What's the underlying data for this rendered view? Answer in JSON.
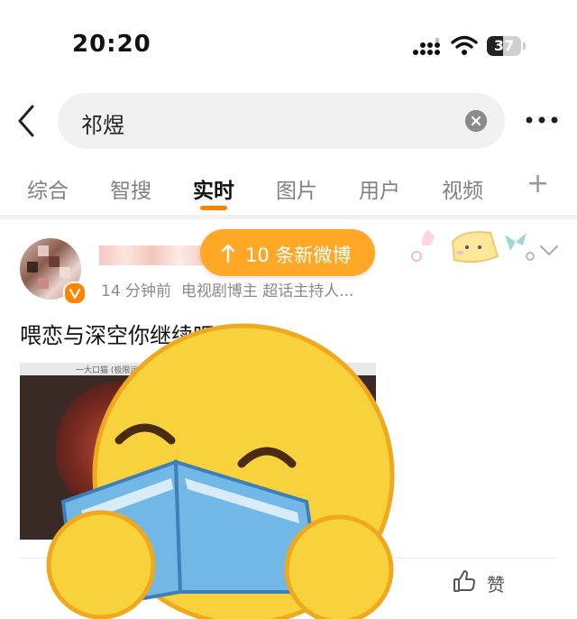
{
  "status_bar": {
    "time": "20:20",
    "battery_level": "37",
    "icons": [
      "cellular-signal-icon",
      "wifi-icon",
      "battery-icon"
    ]
  },
  "search": {
    "query": "祁煜",
    "icons": [
      "back-icon",
      "clear-icon",
      "more-icon"
    ]
  },
  "tabs": [
    {
      "label": "综合",
      "active": false
    },
    {
      "label": "智搜",
      "active": false
    },
    {
      "label": "实时",
      "active": true
    },
    {
      "label": "图片",
      "active": false
    },
    {
      "label": "用户",
      "active": false
    },
    {
      "label": "视频",
      "active": false
    }
  ],
  "tab_add_label": "+",
  "new_posts_pill": {
    "label": "10 条新微博"
  },
  "post": {
    "time_ago": "14 分钟前",
    "user_tags": "电视剧博主 超话主持人...",
    "text": "喂恋与深空你继续吧",
    "image_caption": "一大口猫 (极限运甲)"
  },
  "actions": {
    "like_label": "赞"
  },
  "accent_color": "#ff8200",
  "pill_color": "#ffa726"
}
